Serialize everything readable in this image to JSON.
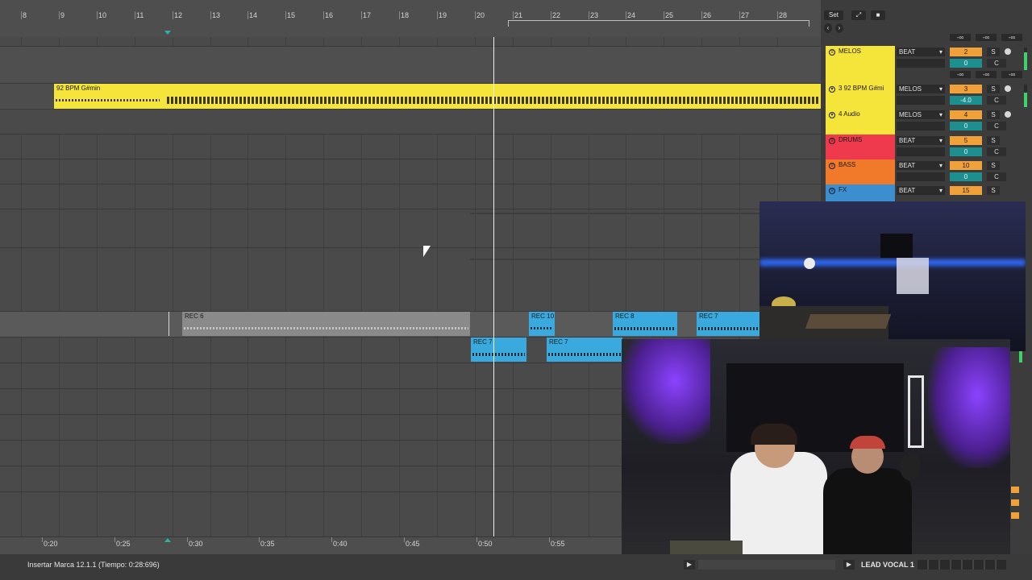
{
  "ruler": {
    "bars": [
      "8",
      "9",
      "10",
      "11",
      "12",
      "13",
      "14",
      "15",
      "16",
      "17",
      "18",
      "19",
      "20",
      "21",
      "22",
      "23",
      "24",
      "25",
      "26",
      "27",
      "28"
    ]
  },
  "time_ruler": {
    "labels": [
      "0:20",
      "0:25",
      "0:30",
      "0:35",
      "0:40",
      "0:45",
      "0:50",
      "0:55"
    ]
  },
  "clips": {
    "main_audio": {
      "label": "92 BPM G#min",
      "color": "#f5e43a"
    },
    "rec6": {
      "label": "REC 6",
      "color": "#8a8a8a"
    },
    "rec10": {
      "label": "REC 10",
      "color": "#3aa9dd"
    },
    "rec8": {
      "label": "REC 8",
      "color": "#3aa9dd"
    },
    "rec7_top": {
      "label": "REC 7",
      "color": "#3aa9dd"
    },
    "rec7_a": {
      "label": "REC 7",
      "color": "#3aa9dd"
    },
    "rec7_b": {
      "label": "REC 7",
      "color": "#3aa9dd"
    }
  },
  "header": {
    "set_label": "Set",
    "minus_inf_1": "-∞",
    "minus_inf_2": "-∞",
    "minus_inf_3": "-∞",
    "minus_inf_4": "-∞",
    "minus_inf_5": "-∞",
    "minus_inf_6": "-∞"
  },
  "tracks": [
    {
      "name": "MELOS",
      "color": "#f5e43a",
      "input": "BEAT",
      "number": "2",
      "volume": "0",
      "solo": "S",
      "pan": "C",
      "armed": true
    },
    {
      "name": "3 92 BPM G#mi",
      "color": "#f5e43a",
      "input": "MELOS",
      "number": "3",
      "volume": "-4.0",
      "solo": "S",
      "pan": "C",
      "armed": true
    },
    {
      "name": "4 Audio",
      "color": "#f5e43a",
      "input": "MELOS",
      "number": "4",
      "volume": "0",
      "solo": "S",
      "pan": "C",
      "armed": true
    },
    {
      "name": "DRUMS",
      "color": "#ef3a4d",
      "input": "BEAT",
      "number": "5",
      "volume": "0",
      "solo": "S",
      "pan": "C",
      "armed": false
    },
    {
      "name": "BASS",
      "color": "#f07a2a",
      "input": "BEAT",
      "number": "10",
      "volume": "0",
      "solo": "S",
      "pan": "C",
      "armed": false
    },
    {
      "name": "FX",
      "color": "#3b8fcf",
      "input": "BEAT",
      "number": "15",
      "volume": "",
      "solo": "S",
      "pan": "",
      "armed": false
    }
  ],
  "status": {
    "message": "Insertar Marca 12.1.1 (Tiempo: 0:28:696)",
    "track_name": "LEAD VOCAL 1"
  }
}
